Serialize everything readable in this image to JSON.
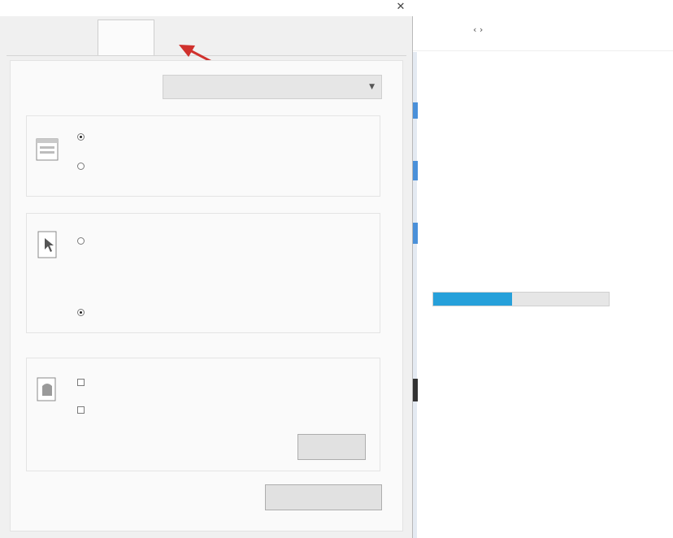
{
  "dialog": {
    "title": "",
    "close_glyph": "✕",
    "tabs": [
      {
        "label": ""
      },
      {
        "label": ""
      },
      {
        "label": ""
      }
    ],
    "active_tab": 2,
    "annotation_arrow_color": "#d0312d",
    "open_explorer": {
      "label": "",
      "value": ""
    },
    "privacy_group": {
      "title": "",
      "options": [
        {
          "label": "",
          "checked": true
        },
        {
          "label": "",
          "checked": false
        }
      ]
    },
    "click_group": {
      "title": "",
      "options": [
        {
          "label": "",
          "checked": false
        },
        {
          "label": "",
          "checked": true
        }
      ],
      "sub_notes": [
        "",
        ""
      ]
    },
    "history_group": {
      "title": "",
      "checkboxes": [
        {
          "label": "",
          "checked": false
        },
        {
          "label": "",
          "checked": false
        }
      ],
      "clear_label": "",
      "clear_button": ""
    },
    "restore_button": ""
  },
  "explorer": {
    "nav_arrows": "‹ ›",
    "path": "",
    "quick_items": [
      "",
      "",
      ""
    ],
    "drives": [
      {
        "name": "",
        "used_fraction": 0.45,
        "free_text": ""
      },
      {
        "name": "",
        "sub": "",
        "used_fraction": null,
        "free_text": ""
      }
    ]
  }
}
